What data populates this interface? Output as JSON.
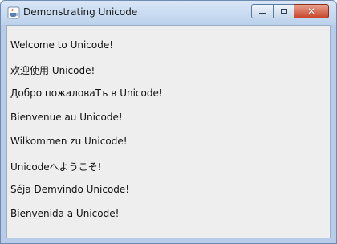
{
  "window": {
    "title": "Demonstrating Unicode",
    "icon": "java-cup-icon",
    "controls": {
      "minimize_icon": "minimize-icon",
      "maximize_icon": "maximize-icon",
      "close_label": "✕"
    }
  },
  "labels": [
    "Welcome to Unicode!",
    "欢迎使用  Unicode!",
    "Добро пожаловаТъ в Unicode!",
    "Bienvenue au Unicode!",
    "Wilkommen zu Unicode!",
    "Unicodeへようこそ!",
    "Séja Demvindo Unicode!",
    "Bienvenida a Unicode!"
  ],
  "colors": {
    "title_bar": "#c9dcf2",
    "close_button": "#c9452c",
    "content_background": "#eeeeee"
  }
}
